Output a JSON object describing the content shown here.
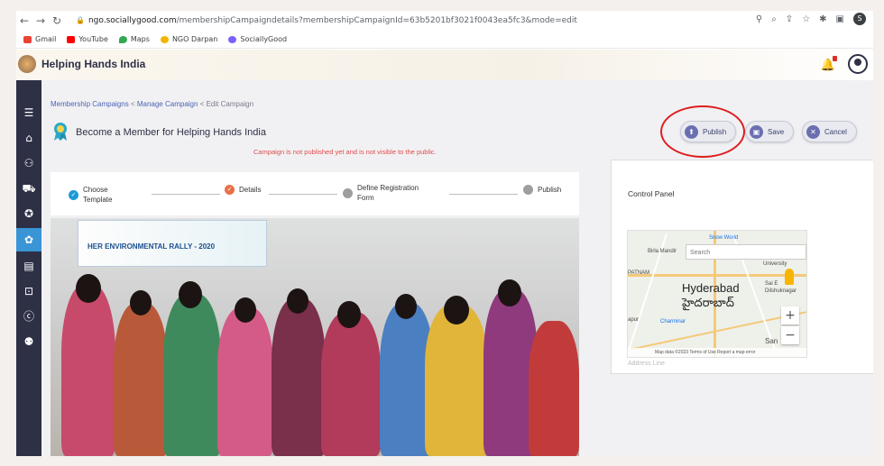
{
  "browser": {
    "url_host": "ngo.sociallygood.com",
    "url_path": "/membershipCampaigndetails?membershipCampaignId=63b5201bf3021f0043ea5fc3&mode=edit",
    "profile_letter": "S",
    "bookmarks": [
      "Gmail",
      "YouTube",
      "Maps",
      "NGO Darpan",
      "SociallyGood"
    ]
  },
  "app": {
    "title": "Helping Hands India"
  },
  "breadcrumb": {
    "item1": "Membership Campaigns",
    "sep": "<",
    "item2": "Manage Campaign",
    "item3": "Edit Campaign"
  },
  "page": {
    "title": "Become a Member for Helping Hands India",
    "warning": "Campaign is not published yet and is not visible to the public."
  },
  "actions": {
    "publish": "Publish",
    "save": "Save",
    "cancel": "Cancel"
  },
  "stepper": {
    "steps": [
      {
        "label_line1": "Choose",
        "label_line2": "Template",
        "state": "done"
      },
      {
        "label_line1": "Details",
        "label_line2": "",
        "state": "current"
      },
      {
        "label_line1": "Define Registration",
        "label_line2": "Form",
        "state": "pending"
      },
      {
        "label_line1": "Publish",
        "label_line2": "",
        "state": "pending"
      }
    ]
  },
  "photo": {
    "banner_text": "HER ENVIRONMENTAL RALLY - 2020"
  },
  "panel": {
    "title": "Control Panel",
    "address_placeholder": "Address Line",
    "map": {
      "search_placeholder": "Search",
      "city_en": "Hyderabad",
      "city_te": "హైదరాబాద్",
      "labels": [
        "Birla Mandir",
        "Snow World",
        "University",
        "Dilshuknagar",
        "Charminar",
        "Sai E",
        "PATNAM",
        "apur",
        "San"
      ],
      "footer": "Map data ©2023   Terms of Use   Report a map error",
      "zoom_in": "+",
      "zoom_out": "−"
    }
  }
}
